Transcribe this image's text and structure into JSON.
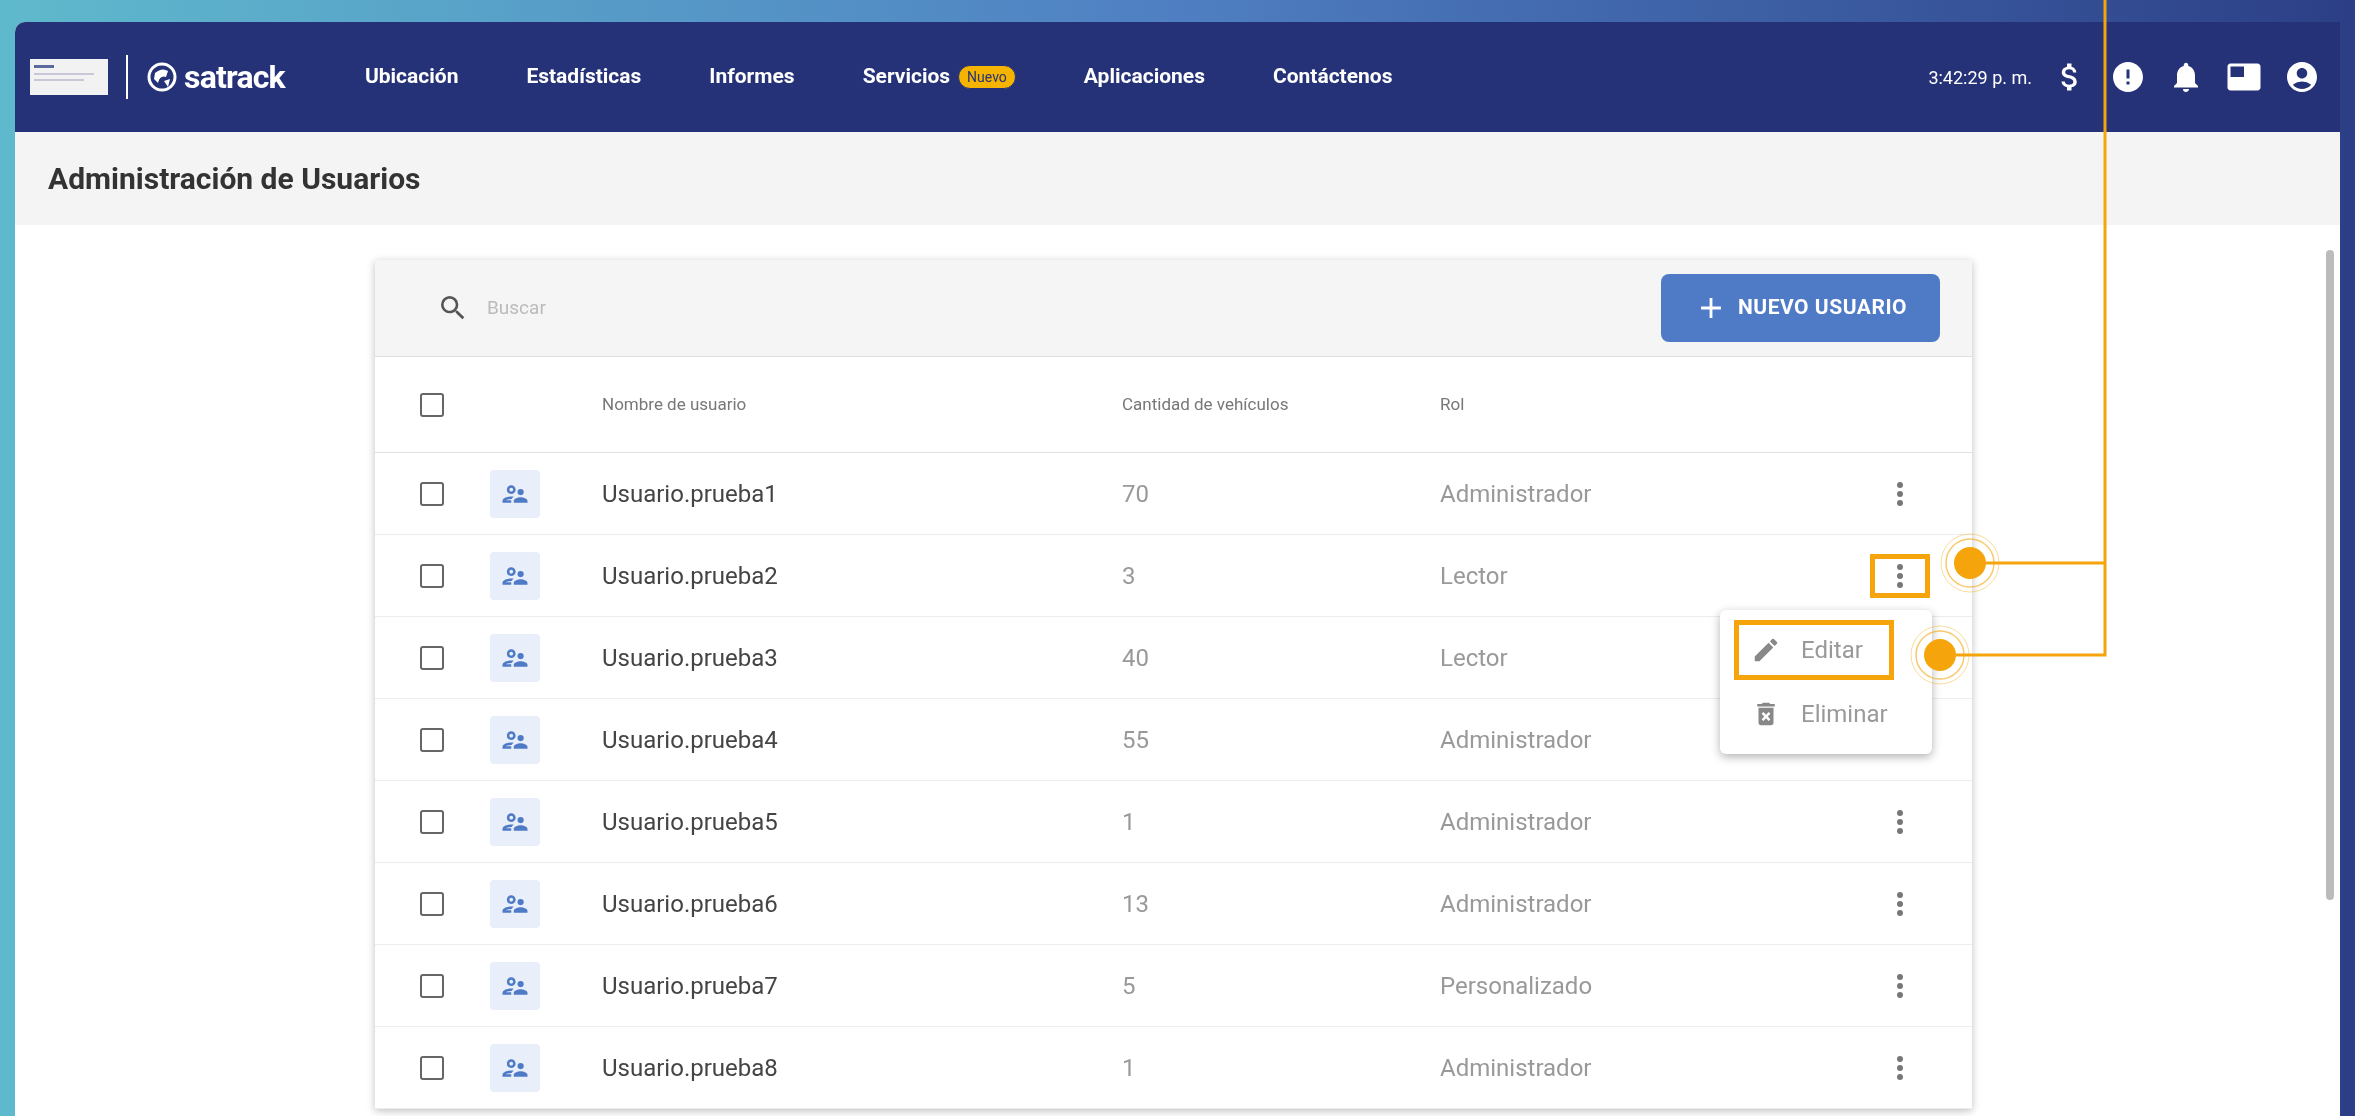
{
  "nav": {
    "brand": "satrack",
    "items": [
      {
        "label": "Ubicación"
      },
      {
        "label": "Estadísticas"
      },
      {
        "label": "Informes"
      },
      {
        "label": "Servicios",
        "badge": "Nuevo"
      },
      {
        "label": "Aplicaciones"
      },
      {
        "label": "Contáctenos"
      }
    ],
    "time": "3:42:29 p. m."
  },
  "page_title": "Administración de Usuarios",
  "search": {
    "placeholder": "Buscar"
  },
  "new_button": "NUEVO USUARIO",
  "select_all": {
    "checked": false
  },
  "columns": [
    "Nombre de usuario",
    "Cantidad de vehículos",
    "Rol"
  ],
  "rows": [
    {
      "checked": false,
      "name": "Usuario.prueba1",
      "vehicles": "70",
      "role": "Administrador",
      "highlighted": false
    },
    {
      "checked": false,
      "name": "Usuario.prueba2",
      "vehicles": "3",
      "role": "Lector",
      "highlighted": true
    },
    {
      "checked": false,
      "name": "Usuario.prueba3",
      "vehicles": "40",
      "role": "Lector"
    },
    {
      "checked": false,
      "name": "Usuario.prueba4",
      "vehicles": "55",
      "role": "Administrador"
    },
    {
      "checked": false,
      "name": "Usuario.prueba5",
      "vehicles": "1",
      "role": "Administrador",
      "highlighted": false
    },
    {
      "checked": false,
      "name": "Usuario.prueba6",
      "vehicles": "13",
      "role": "Administrador",
      "highlighted": false
    },
    {
      "checked": false,
      "name": "Usuario.prueba7",
      "vehicles": "5",
      "role": "Personalizado",
      "highlighted": false
    },
    {
      "checked": false,
      "name": "Usuario.prueba8",
      "vehicles": "1",
      "role": "Administrador",
      "highlighted": false
    }
  ],
  "row_menu": {
    "items": [
      {
        "kind": "edit",
        "label": "Editar",
        "highlighted": true
      },
      {
        "kind": "delete",
        "label": "Eliminar",
        "highlighted": false
      }
    ]
  }
}
